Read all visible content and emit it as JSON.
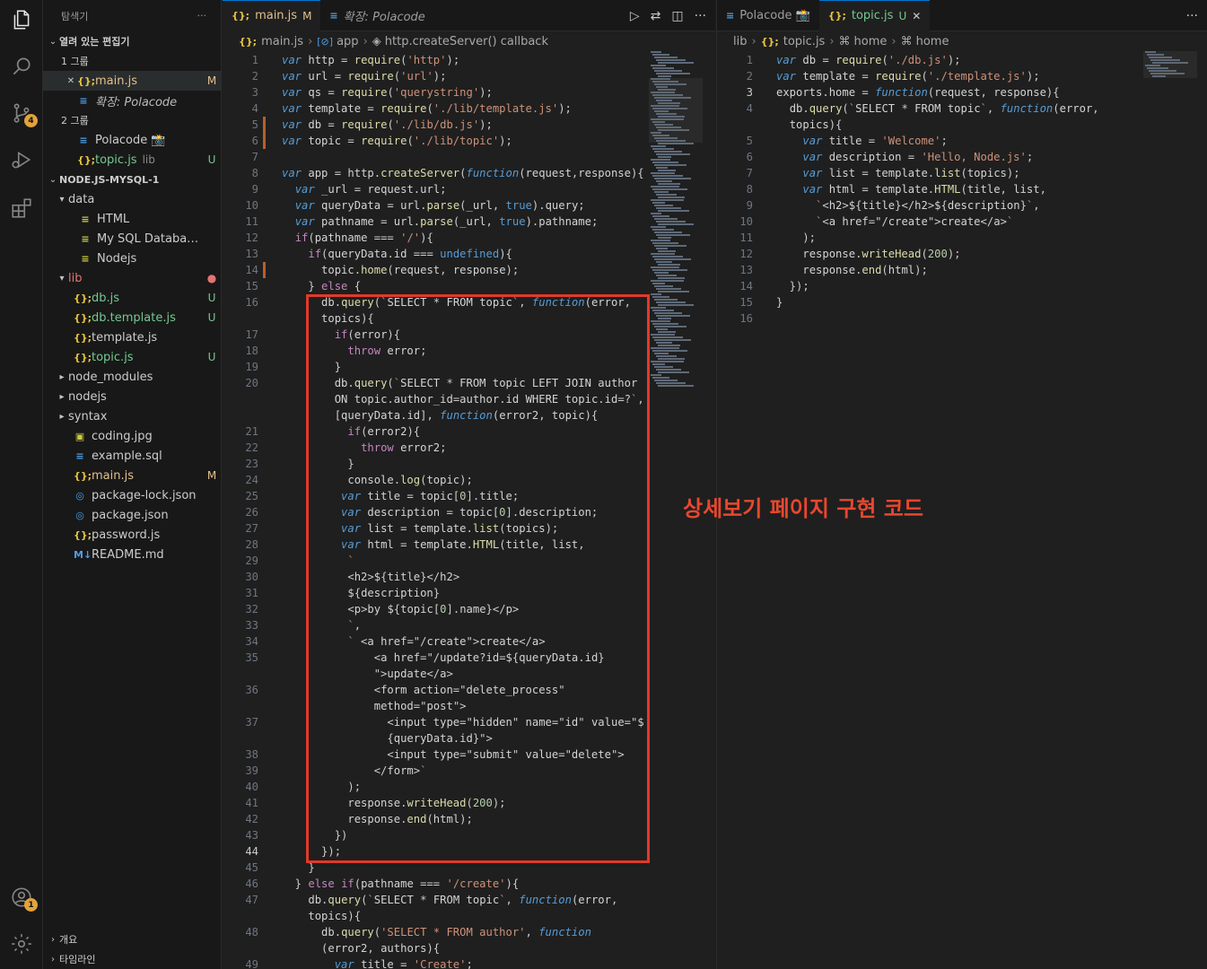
{
  "sidebar": {
    "title": "탐색기",
    "more": "···",
    "open_editors": "열려 있는 편집기",
    "group1": "1 그룹",
    "group2": "2 그룹",
    "open_items": [
      {
        "icon": "{};",
        "label": "main.js",
        "status": "M",
        "close": "✕"
      },
      {
        "icon": "≡",
        "label": "확장: Polacode",
        "status": ""
      },
      {
        "icon": "≡",
        "label": "Polacode 📸",
        "status": ""
      },
      {
        "icon": "{};",
        "label": "topic.js",
        "extra": "lib",
        "status": "U"
      }
    ],
    "project": "NODE.JS-MYSQL-1",
    "tree": [
      {
        "chev": "▾",
        "icon": "",
        "label": "data",
        "status": ""
      },
      {
        "chev": "",
        "icon": "≡",
        "label": "HTML",
        "status": ""
      },
      {
        "chev": "",
        "icon": "≡",
        "label": "My SQL Databasse",
        "status": ""
      },
      {
        "chev": "",
        "icon": "≡",
        "label": "Nodejs",
        "status": ""
      },
      {
        "chev": "▾",
        "icon": "",
        "label": "lib",
        "status": "●"
      },
      {
        "chev": "",
        "icon": "{};",
        "label": "db.js",
        "status": "U"
      },
      {
        "chev": "",
        "icon": "{};",
        "label": "db.template.js",
        "status": "U"
      },
      {
        "chev": "",
        "icon": "{};",
        "label": "template.js",
        "status": ""
      },
      {
        "chev": "",
        "icon": "{};",
        "label": "topic.js",
        "status": "U"
      },
      {
        "chev": "▸",
        "icon": "",
        "label": "node_modules",
        "status": ""
      },
      {
        "chev": "▸",
        "icon": "",
        "label": "nodejs",
        "status": ""
      },
      {
        "chev": "▸",
        "icon": "",
        "label": "syntax",
        "status": ""
      },
      {
        "chev": "",
        "icon": "▣",
        "label": "coding.jpg",
        "status": ""
      },
      {
        "chev": "",
        "icon": "≡",
        "label": "example.sql",
        "status": ""
      },
      {
        "chev": "",
        "icon": "{};",
        "label": "main.js",
        "status": "M"
      },
      {
        "chev": "",
        "icon": "◎",
        "label": "package-lock.json",
        "status": ""
      },
      {
        "chev": "",
        "icon": "◎",
        "label": "package.json",
        "status": ""
      },
      {
        "chev": "",
        "icon": "{};",
        "label": "password.js",
        "status": ""
      },
      {
        "chev": "",
        "icon": "M↓",
        "label": "README.md",
        "status": ""
      }
    ],
    "outline": "개요",
    "timeline": "타임라인"
  },
  "activity": {
    "source_control_badge": "4",
    "accounts_badge": "1"
  },
  "left_editor": {
    "tabs": [
      {
        "icon": "{};",
        "label": "main.js",
        "marker": "M"
      },
      {
        "icon": "≡",
        "label": "확장: Polacode",
        "marker": ""
      }
    ],
    "actions": [
      "▷",
      "⇄",
      "◫",
      "···"
    ],
    "breadcrumb": [
      "main.js",
      "app",
      "http.createServer() callback"
    ]
  },
  "right_editor": {
    "tabs": [
      {
        "icon": "≡",
        "label": "Polacode 📸",
        "marker": ""
      },
      {
        "icon": "{};",
        "label": "topic.js",
        "marker": "U"
      }
    ],
    "actions": [
      "···"
    ],
    "breadcrumb": [
      "lib",
      "topic.js",
      "home",
      "home"
    ]
  },
  "left_code": [
    {
      "n": "1",
      "t": "var http = require('http');"
    },
    {
      "n": "2",
      "t": "var url = require('url');"
    },
    {
      "n": "3",
      "t": "var qs = require('querystring');"
    },
    {
      "n": "4",
      "t": "var template = require('./lib/template.js');"
    },
    {
      "n": "5",
      "t": "var db = require('./lib/db.js');"
    },
    {
      "n": "6",
      "t": "var topic = require('./lib/topic');"
    },
    {
      "n": "7",
      "t": ""
    },
    {
      "n": "8",
      "t": "var app = http.createServer(function(request,response){"
    },
    {
      "n": "9",
      "t": "  var _url = request.url;"
    },
    {
      "n": "10",
      "t": "  var queryData = url.parse(_url, true).query;"
    },
    {
      "n": "11",
      "t": "  var pathname = url.parse(_url, true).pathname;"
    },
    {
      "n": "12",
      "t": "  if(pathname === '/'){"
    },
    {
      "n": "13",
      "t": "    if(queryData.id === undefined){"
    },
    {
      "n": "14",
      "t": "      topic.home(request, response);"
    },
    {
      "n": "15",
      "t": "    } else {"
    },
    {
      "n": "16",
      "t": "      db.query(`SELECT * FROM topic`, function(error,"
    },
    {
      "n": "",
      "t": "      topics){"
    },
    {
      "n": "17",
      "t": "        if(error){"
    },
    {
      "n": "18",
      "t": "          throw error;"
    },
    {
      "n": "19",
      "t": "        }"
    },
    {
      "n": "20",
      "t": "        db.query(`SELECT * FROM topic LEFT JOIN author"
    },
    {
      "n": "",
      "t": "        ON topic.author_id=author.id WHERE topic.id=?`,"
    },
    {
      "n": "",
      "t": "        [queryData.id], function(error2, topic){"
    },
    {
      "n": "21",
      "t": "          if(error2){"
    },
    {
      "n": "22",
      "t": "            throw error2;"
    },
    {
      "n": "23",
      "t": "          }"
    },
    {
      "n": "24",
      "t": "          console.log(topic);"
    },
    {
      "n": "25",
      "t": "         var title = topic[0].title;"
    },
    {
      "n": "26",
      "t": "         var description = topic[0].description;"
    },
    {
      "n": "27",
      "t": "         var list = template.list(topics);"
    },
    {
      "n": "28",
      "t": "         var html = template.HTML(title, list,"
    },
    {
      "n": "29",
      "t": "          `"
    },
    {
      "n": "30",
      "t": "          <h2>${title}</h2>"
    },
    {
      "n": "31",
      "t": "          ${description}"
    },
    {
      "n": "32",
      "t": "          <p>by ${topic[0].name}</p>"
    },
    {
      "n": "33",
      "t": "          `,"
    },
    {
      "n": "34",
      "t": "          ` <a href=\"/create\">create</a>"
    },
    {
      "n": "35",
      "t": "              <a href=\"/update?id=${queryData.id}"
    },
    {
      "n": "",
      "t": "              \">update</a>"
    },
    {
      "n": "36",
      "t": "              <form action=\"delete_process\""
    },
    {
      "n": "",
      "t": "              method=\"post\">"
    },
    {
      "n": "37",
      "t": "                <input type=\"hidden\" name=\"id\" value=\"$"
    },
    {
      "n": "",
      "t": "                {queryData.id}\">"
    },
    {
      "n": "38",
      "t": "                <input type=\"submit\" value=\"delete\">"
    },
    {
      "n": "39",
      "t": "              </form>`"
    },
    {
      "n": "40",
      "t": "          );"
    },
    {
      "n": "41",
      "t": "          response.writeHead(200);"
    },
    {
      "n": "42",
      "t": "          response.end(html);"
    },
    {
      "n": "43",
      "t": "        })"
    },
    {
      "n": "44",
      "t": "      });"
    },
    {
      "n": "45",
      "t": "    }"
    },
    {
      "n": "46",
      "t": "  } else if(pathname === '/create'){"
    },
    {
      "n": "47",
      "t": "    db.query(`SELECT * FROM topic`, function(error,"
    },
    {
      "n": "",
      "t": "    topics){"
    },
    {
      "n": "48",
      "t": "      db.query('SELECT * FROM author', function"
    },
    {
      "n": "",
      "t": "      (error2, authors){"
    },
    {
      "n": "49",
      "t": "        var title = 'Create';"
    }
  ],
  "right_code": [
    {
      "n": "1",
      "t": "var db = require('./db.js');"
    },
    {
      "n": "2",
      "t": "var template = require('./template.js');"
    },
    {
      "n": "3",
      "t": "exports.home = function(request, response){"
    },
    {
      "n": "4",
      "t": "  db.query(`SELECT * FROM topic`, function(error,"
    },
    {
      "n": "",
      "t": "  topics){"
    },
    {
      "n": "5",
      "t": "    var title = 'Welcome';"
    },
    {
      "n": "6",
      "t": "    var description = 'Hello, Node.js';"
    },
    {
      "n": "7",
      "t": "    var list = template.list(topics);"
    },
    {
      "n": "8",
      "t": "    var html = template.HTML(title, list,"
    },
    {
      "n": "9",
      "t": "      `<h2>${title}</h2>${description}`,"
    },
    {
      "n": "10",
      "t": "      `<a href=\"/create\">create</a>`"
    },
    {
      "n": "11",
      "t": "    );"
    },
    {
      "n": "12",
      "t": "    response.writeHead(200);"
    },
    {
      "n": "13",
      "t": "    response.end(html);"
    },
    {
      "n": "14",
      "t": "  });"
    },
    {
      "n": "15",
      "t": "}"
    },
    {
      "n": "16",
      "t": ""
    }
  ],
  "annotation": "상세보기 페이지 구현 코드"
}
